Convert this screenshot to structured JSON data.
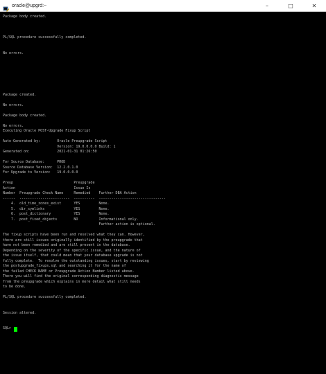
{
  "window": {
    "title": "oracle@upgrd:~",
    "controls": {
      "minimize": "–",
      "maximize": "□",
      "close": "✕"
    }
  },
  "terminal": {
    "lines": [
      "Package body created.",
      "",
      "",
      "",
      "PL/SQL procedure successfully completed.",
      "",
      "",
      "No errors.",
      "",
      "",
      "",
      "",
      "",
      "",
      "",
      "Package created.",
      "",
      "No errors.",
      "",
      "Package body created.",
      "",
      "No errors.",
      "Executing Oracle POST-Upgrade Fixup Script",
      "",
      "Auto-Generated by:        Oracle Preupgrade Script",
      "                          Version: 19.0.0.0.0 Build: 1",
      "Generated on:             2021-01-31 01:26:50",
      "",
      "For Source Database:      PROD",
      "Source Database Version:  12.2.0.1.0",
      "For Upgrade to Version:   19.0.0.0.0",
      "",
      "Preup                             Preupgrade",
      "Action                            Issue Is",
      "Number  Preupgrade Check Name     Remedied    Further DBA Action",
      "------  ------------------------  ----------  --------------------------------",
      "    4.  old_time_zones_exist      YES         None.",
      "    5.  dir_symlinks              YES         None.",
      "    6.  post_dictionary           YES         None.",
      "    7.  post_fixed_objects        NO          Informational only.",
      "                                              Further action is optional.",
      "",
      "The fixup scripts have been run and resolved what they can. However,",
      "there are still issues originally identified by the preupgrade that",
      "have not been remedied and are still present in the database.",
      "Depending on the severity of the specific issue, and the nature of",
      "the issue itself, that could mean that your database upgrade is not",
      "fully complete.  To resolve the outstanding issues, start by reviewing",
      "the postupgrade_fixups.sql and searching it for the name of",
      "the failed CHECK NAME or Preupgrade Action Number listed above.",
      "There you will find the original corresponding diagnostic message",
      "from the preupgrade which explains in more detail what still needs",
      "to be done.",
      "",
      "PL/SQL procedure successfully completed.",
      "",
      "",
      "Session altered.",
      "",
      ""
    ],
    "prompt": "SQL> "
  },
  "colors": {
    "background": "#000000",
    "text": "#c0c0c0",
    "cursor": "#00ff00",
    "titlebar": "#ffffff"
  }
}
